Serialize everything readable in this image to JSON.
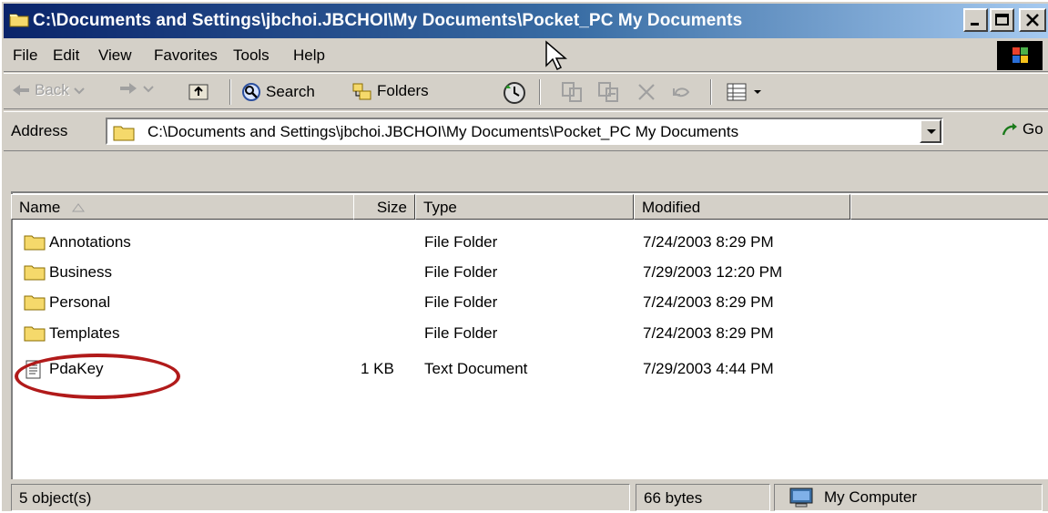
{
  "window": {
    "title": "C:\\Documents and Settings\\jbchoi.JBCHOI\\My Documents\\Pocket_PC My Documents",
    "icon": "folder-icon"
  },
  "menu": [
    "File",
    "Edit",
    "View",
    "Favorites",
    "Tools",
    "Help"
  ],
  "toolbar": {
    "back": "Back",
    "search": "Search",
    "folders": "Folders"
  },
  "address": {
    "label": "Address",
    "value": "C:\\Documents and Settings\\jbchoi.JBCHOI\\My Documents\\Pocket_PC My Documents",
    "go": "Go"
  },
  "columns": [
    "Name",
    "Size",
    "Type",
    "Modified"
  ],
  "files": [
    {
      "name": "Annotations",
      "size": "",
      "type": "File Folder",
      "modified": "7/24/2003 8:29 PM",
      "icon": "folder-icon"
    },
    {
      "name": "Business",
      "size": "",
      "type": "File Folder",
      "modified": "7/29/2003 12:20 PM",
      "icon": "folder-icon"
    },
    {
      "name": "Personal",
      "size": "",
      "type": "File Folder",
      "modified": "7/24/2003 8:29 PM",
      "icon": "folder-icon"
    },
    {
      "name": "Templates",
      "size": "",
      "type": "File Folder",
      "modified": "7/24/2003 8:29 PM",
      "icon": "folder-icon"
    },
    {
      "name": "PdaKey",
      "size": "1 KB",
      "type": "Text Document",
      "modified": "7/29/2003 4:44 PM",
      "icon": "text-document-icon"
    }
  ],
  "status": {
    "objects": "5 object(s)",
    "bytes": "66 bytes",
    "zone": "My Computer"
  },
  "colors": {
    "title_start": "#0a246a",
    "title_end": "#a6caf0",
    "chrome": "#d4d0c8",
    "annotation": "#b11a1a"
  }
}
